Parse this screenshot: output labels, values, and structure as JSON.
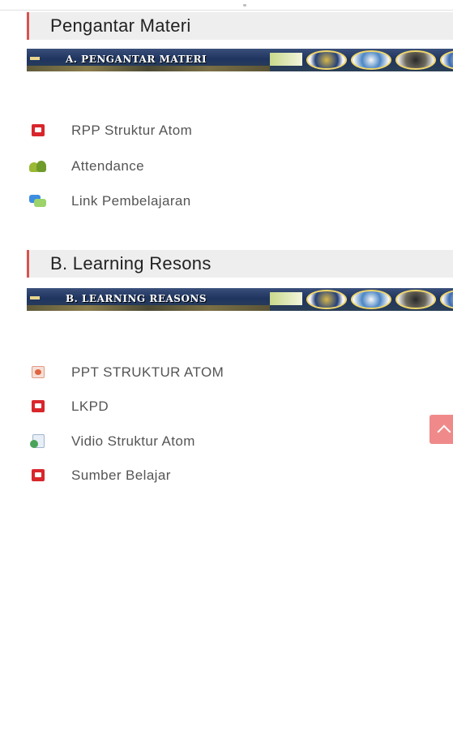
{
  "sections": [
    {
      "title": "Pengantar Materi",
      "banner_label": "A. PENGANTAR MATERI",
      "activities": [
        {
          "label": "RPP Struktur Atom",
          "icon": "pdf-icon"
        },
        {
          "label": "Attendance",
          "icon": "attendance-icon"
        },
        {
          "label": "Link Pembelajaran",
          "icon": "forum-icon"
        }
      ]
    },
    {
      "title": "B. Learning Resons",
      "banner_label": "B. LEARNING REASONS",
      "activities": [
        {
          "label": "PPT STRUKTUR ATOM",
          "icon": "ppt-icon"
        },
        {
          "label": "LKPD",
          "icon": "pdf-icon"
        },
        {
          "label": "Vidio Struktur Atom",
          "icon": "file-icon"
        },
        {
          "label": "Sumber Belajar",
          "icon": "pdf-icon"
        }
      ]
    }
  ],
  "colors": {
    "section_accent": "#d9534f",
    "header_bg": "#eeeeee",
    "scroll_top_bg": "#f08a8a"
  },
  "scroll_top_icon": "chevron-up-icon"
}
